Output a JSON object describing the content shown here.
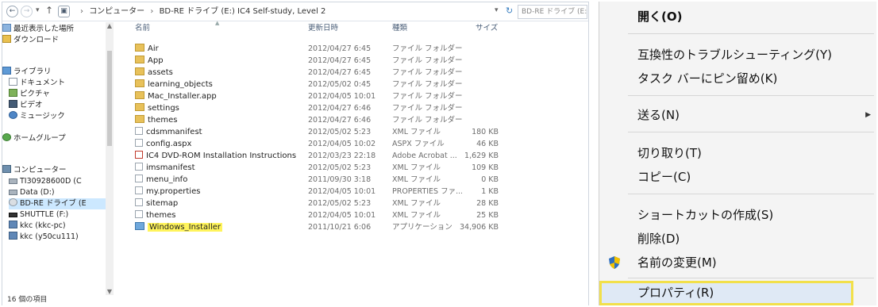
{
  "explorer": {
    "address": {
      "segments": [
        "コンピューター",
        "BD-RE ドライブ (E:) IC4 Self-study, Level 2"
      ],
      "search_placeholder": "BD-RE ドライブ (E:..."
    },
    "nav": {
      "items": [
        {
          "label": "最近表示した場所",
          "icon": "recent-places-icon"
        },
        {
          "label": "ダウンロード",
          "icon": "downloads-icon"
        },
        {
          "label": "ライブラリ",
          "icon": "library-icon"
        },
        {
          "label": "ドキュメント",
          "icon": "documents-icon"
        },
        {
          "label": "ピクチャ",
          "icon": "pictures-icon"
        },
        {
          "label": "ビデオ",
          "icon": "videos-icon"
        },
        {
          "label": "ミュージック",
          "icon": "music-icon"
        },
        {
          "label": "ホームグループ",
          "icon": "homegroup-icon"
        },
        {
          "label": "コンピューター",
          "icon": "computer-icon"
        },
        {
          "label": "TI30928600D (C",
          "icon": "drive-icon"
        },
        {
          "label": "Data (D:)",
          "icon": "drive-icon"
        },
        {
          "label": "BD-RE ドライブ (E",
          "icon": "disc-drive-icon"
        },
        {
          "label": "SHUTTLE (F:)",
          "icon": "usb-drive-icon"
        },
        {
          "label": "kkc (kkc-pc)",
          "icon": "network-icon"
        },
        {
          "label": "kkc (y50cu111)",
          "icon": "network-icon"
        }
      ]
    },
    "columns": {
      "name": "名前",
      "date": "更新日時",
      "type": "種類",
      "size": "サイズ"
    },
    "files": [
      {
        "name": "Air",
        "date": "2012/04/27 6:45",
        "type": "ファイル フォルダー",
        "size": "",
        "kind": "folder"
      },
      {
        "name": "App",
        "date": "2012/04/27 6:45",
        "type": "ファイル フォルダー",
        "size": "",
        "kind": "folder"
      },
      {
        "name": "assets",
        "date": "2012/04/27 6:45",
        "type": "ファイル フォルダー",
        "size": "",
        "kind": "folder"
      },
      {
        "name": "learning_objects",
        "date": "2012/05/02 0:45",
        "type": "ファイル フォルダー",
        "size": "",
        "kind": "folder"
      },
      {
        "name": "Mac_Installer.app",
        "date": "2012/04/05 10:01",
        "type": "ファイル フォルダー",
        "size": "",
        "kind": "folder"
      },
      {
        "name": "settings",
        "date": "2012/04/27 6:46",
        "type": "ファイル フォルダー",
        "size": "",
        "kind": "folder"
      },
      {
        "name": "themes",
        "date": "2012/04/27 6:46",
        "type": "ファイル フォルダー",
        "size": "",
        "kind": "folder"
      },
      {
        "name": "cdsmmanifest",
        "date": "2012/05/02 5:23",
        "type": "XML ファイル",
        "size": "180 KB",
        "kind": "file"
      },
      {
        "name": "config.aspx",
        "date": "2012/04/05 10:02",
        "type": "ASPX ファイル",
        "size": "46 KB",
        "kind": "file"
      },
      {
        "name": "IC4 DVD-ROM Installation Instructions",
        "date": "2012/03/23 22:18",
        "type": "Adobe Acrobat ...",
        "size": "1,629 KB",
        "kind": "pdf"
      },
      {
        "name": "imsmanifest",
        "date": "2012/05/02 5:23",
        "type": "XML ファイル",
        "size": "109 KB",
        "kind": "file"
      },
      {
        "name": "menu_info",
        "date": "2011/09/30 3:18",
        "type": "XML ファイル",
        "size": "0 KB",
        "kind": "file"
      },
      {
        "name": "my.properties",
        "date": "2012/04/05 10:01",
        "type": "PROPERTIES ファ...",
        "size": "1 KB",
        "kind": "file"
      },
      {
        "name": "sitemap",
        "date": "2012/05/02 5:23",
        "type": "XML ファイル",
        "size": "28 KB",
        "kind": "file"
      },
      {
        "name": "themes",
        "date": "2012/04/05 10:01",
        "type": "XML ファイル",
        "size": "25 KB",
        "kind": "file"
      },
      {
        "name": "Windows_Installer",
        "date": "2011/10/21 6:06",
        "type": "アプリケーション",
        "size": "34,906 KB",
        "kind": "exe",
        "highlighted": true
      }
    ],
    "status": "16 個の項目"
  },
  "context_menu": {
    "items": [
      {
        "label": "開く(O)",
        "bold": true
      },
      {
        "label": "互換性のトラブルシューティング(Y)"
      },
      {
        "label": "タスク バーにピン留め(K)"
      },
      {
        "label": "送る(N)",
        "submenu": true
      },
      {
        "label": "切り取り(T)"
      },
      {
        "label": "コピー(C)"
      },
      {
        "label": "ショートカットの作成(S)"
      },
      {
        "label": "削除(D)"
      },
      {
        "label": "名前の変更(M)",
        "icon": "shield-icon"
      },
      {
        "label": "プロパティ(R)",
        "highlighted": true
      }
    ],
    "colors": {
      "highlight_border": "#f2e04a",
      "file_highlight": "#fff45c"
    }
  }
}
